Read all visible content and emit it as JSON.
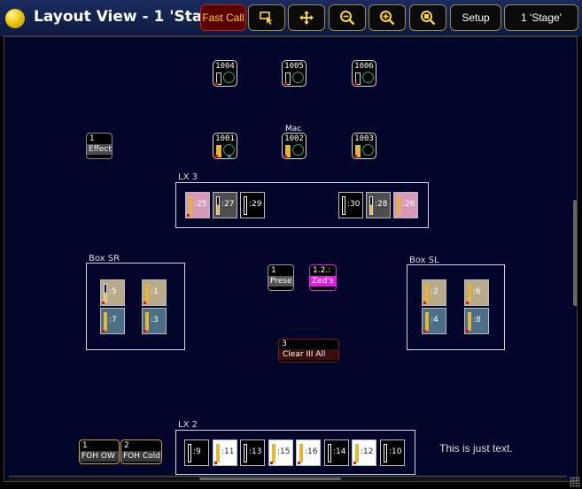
{
  "window": {
    "title": "Layout View - 1 'Sta",
    "stage_button": "1 'Stage'"
  },
  "toolbar": {
    "fast_call": "Fast Call",
    "select_icon": "cursor-select-icon",
    "move_icon": "move-arrows-icon",
    "zoom_out_icon": "zoom-out-icon",
    "zoom_in_icon": "zoom-in-icon",
    "zoom_fit_icon": "zoom-fit-icon",
    "setup": "Setup"
  },
  "fixtures": [
    {
      "id": "1004"
    },
    {
      "id": "1005"
    },
    {
      "id": "1006"
    },
    {
      "id": "1001"
    },
    {
      "id": "1002",
      "label": "Mac"
    },
    {
      "id": "1003"
    }
  ],
  "objects": {
    "effect": {
      "num": "1",
      "label": "Effect"
    },
    "preset": {
      "num": "1",
      "label": "Prese"
    },
    "zeds": {
      "num": "1.2.:",
      "label": "Zed's"
    },
    "clear": {
      "num": "3",
      "label": "Clear III All"
    },
    "foh_ow": {
      "num": "1",
      "label": "FOH OW"
    },
    "foh_cold": {
      "num": "2",
      "label": "FOH Cold"
    }
  },
  "groups": {
    "lx3": {
      "label": "LX 3",
      "channels": [
        ":25",
        ":27",
        ":29",
        ":30",
        ":28",
        ":26"
      ]
    },
    "box_sr": {
      "label": "Box SR",
      "channels": [
        ":5",
        ":1",
        ":7",
        ":3"
      ]
    },
    "box_sl": {
      "label": "Box SL",
      "channels": [
        ":2",
        ":6",
        ":4",
        ":8"
      ]
    },
    "lx2": {
      "label": "LX 2",
      "channels": [
        ":9",
        ":11",
        ":13",
        ":15",
        ":16",
        ":14",
        ":12",
        ":10"
      ]
    }
  },
  "note": "This is just text.",
  "colors": {
    "accent": "#ffd24a",
    "background": "#02062a",
    "fast_call": "#5a0000",
    "level": "#e8b530",
    "magenta": "#e020e0"
  }
}
